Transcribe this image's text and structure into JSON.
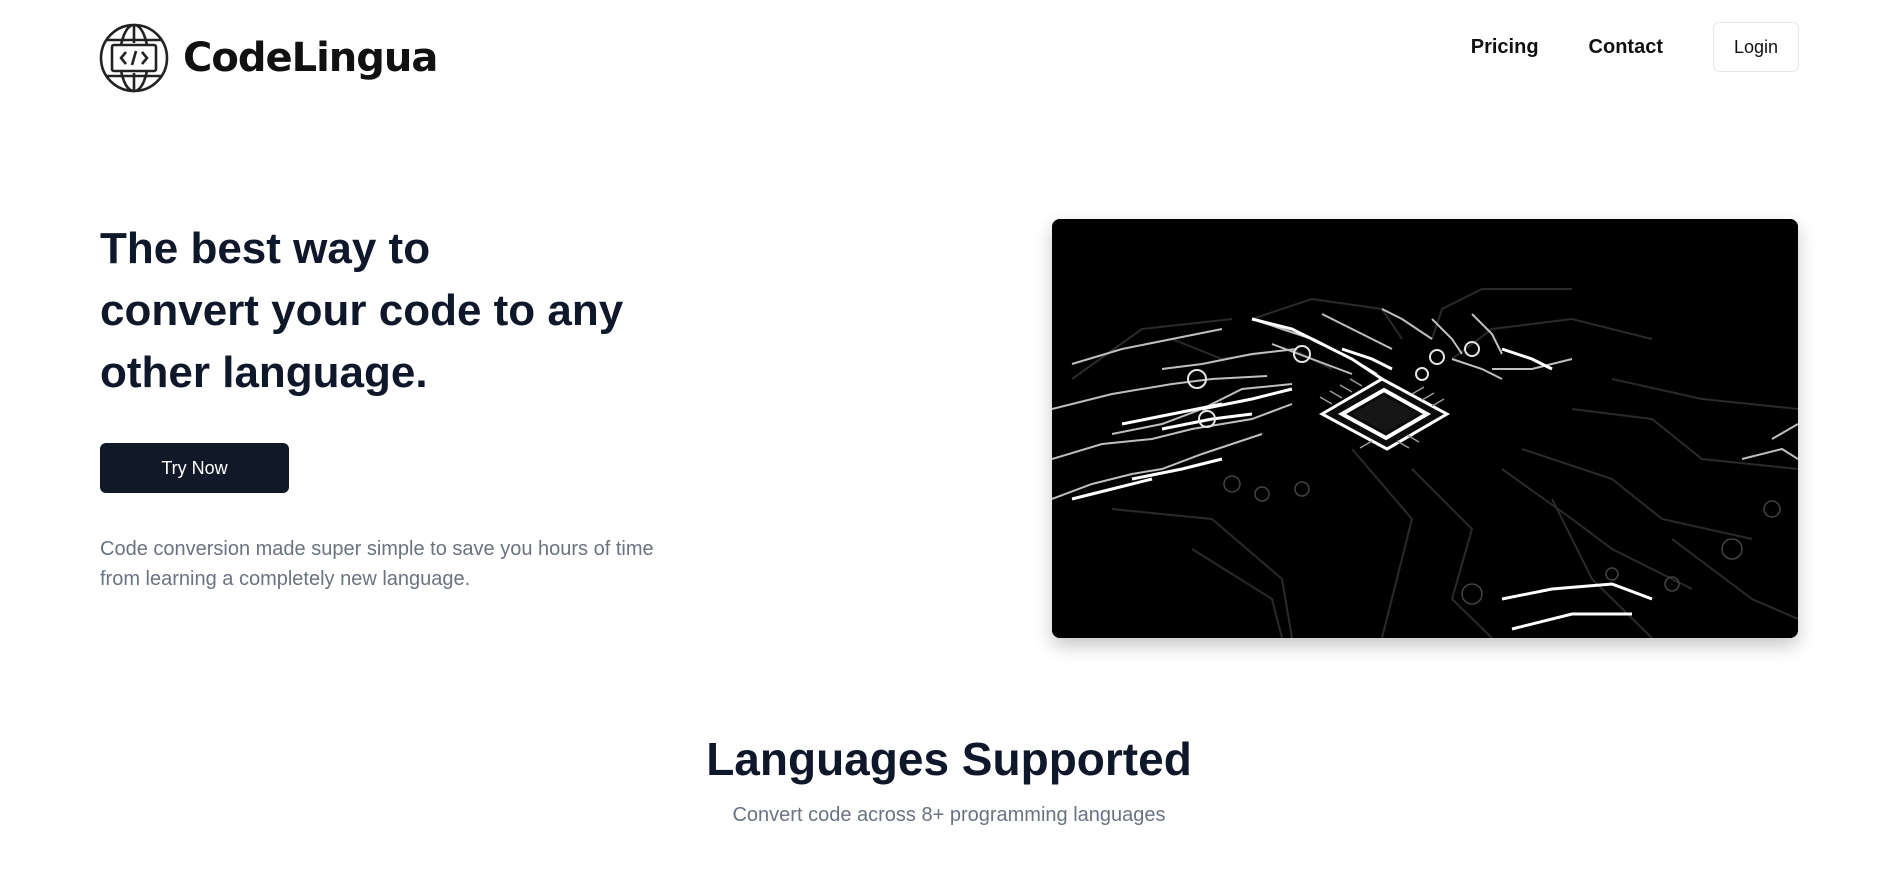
{
  "brand": {
    "name": "CodeLingua",
    "logo_icon": "globe-code-icon"
  },
  "nav": {
    "items": [
      {
        "label": "Pricing"
      },
      {
        "label": "Contact"
      }
    ],
    "login_label": "Login"
  },
  "hero": {
    "title_lines": [
      "The best way to",
      "convert your code to any",
      "other language."
    ],
    "cta_label": "Try Now",
    "description_lines": [
      "Code conversion made super simple to save you hours of time",
      "from learning a completely new language."
    ],
    "image_icon": "circuit-board-chip-image"
  },
  "languages": {
    "title": "Languages Supported",
    "subtitle": "Convert code across 8+ programming languages"
  },
  "colors": {
    "cta_bg": "#111827",
    "text_primary": "#0f172a",
    "text_muted": "#6b7280",
    "image_bg": "#000000"
  }
}
